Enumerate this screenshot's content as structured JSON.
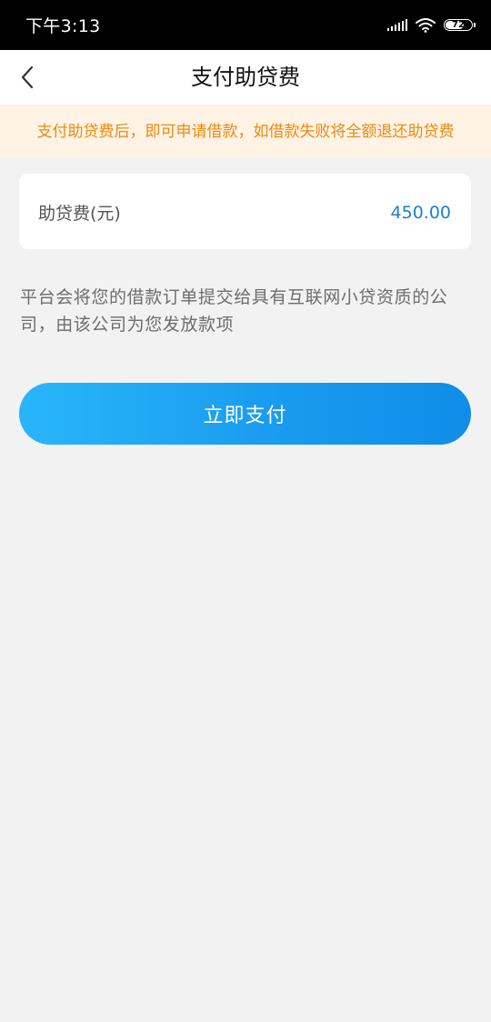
{
  "status_bar": {
    "time": "下午3:13",
    "battery_level": 72,
    "battery_text": "72",
    "icons": [
      "signal-icon",
      "wifi-icon",
      "battery-icon"
    ]
  },
  "nav": {
    "back_icon": "chevron-left-icon",
    "title": "支付助贷费"
  },
  "notice": {
    "text": "支付助贷费后，即可申请借款，如借款失败将全额退还助贷费"
  },
  "fee_card": {
    "label": "助贷费(元)",
    "value": "450.00"
  },
  "description": "平台会将您的借款订单提交给具有互联网小贷资质的公司，由该公司为您发放款项",
  "pay_button": {
    "label": "立即支付"
  },
  "colors": {
    "notice_text": "#f0890e",
    "notice_bg": "#fff3e6",
    "fee_value": "#1b82c8",
    "button_start": "#29b6f9",
    "button_end": "#0f8de8",
    "page_bg": "#f2f2f2"
  }
}
